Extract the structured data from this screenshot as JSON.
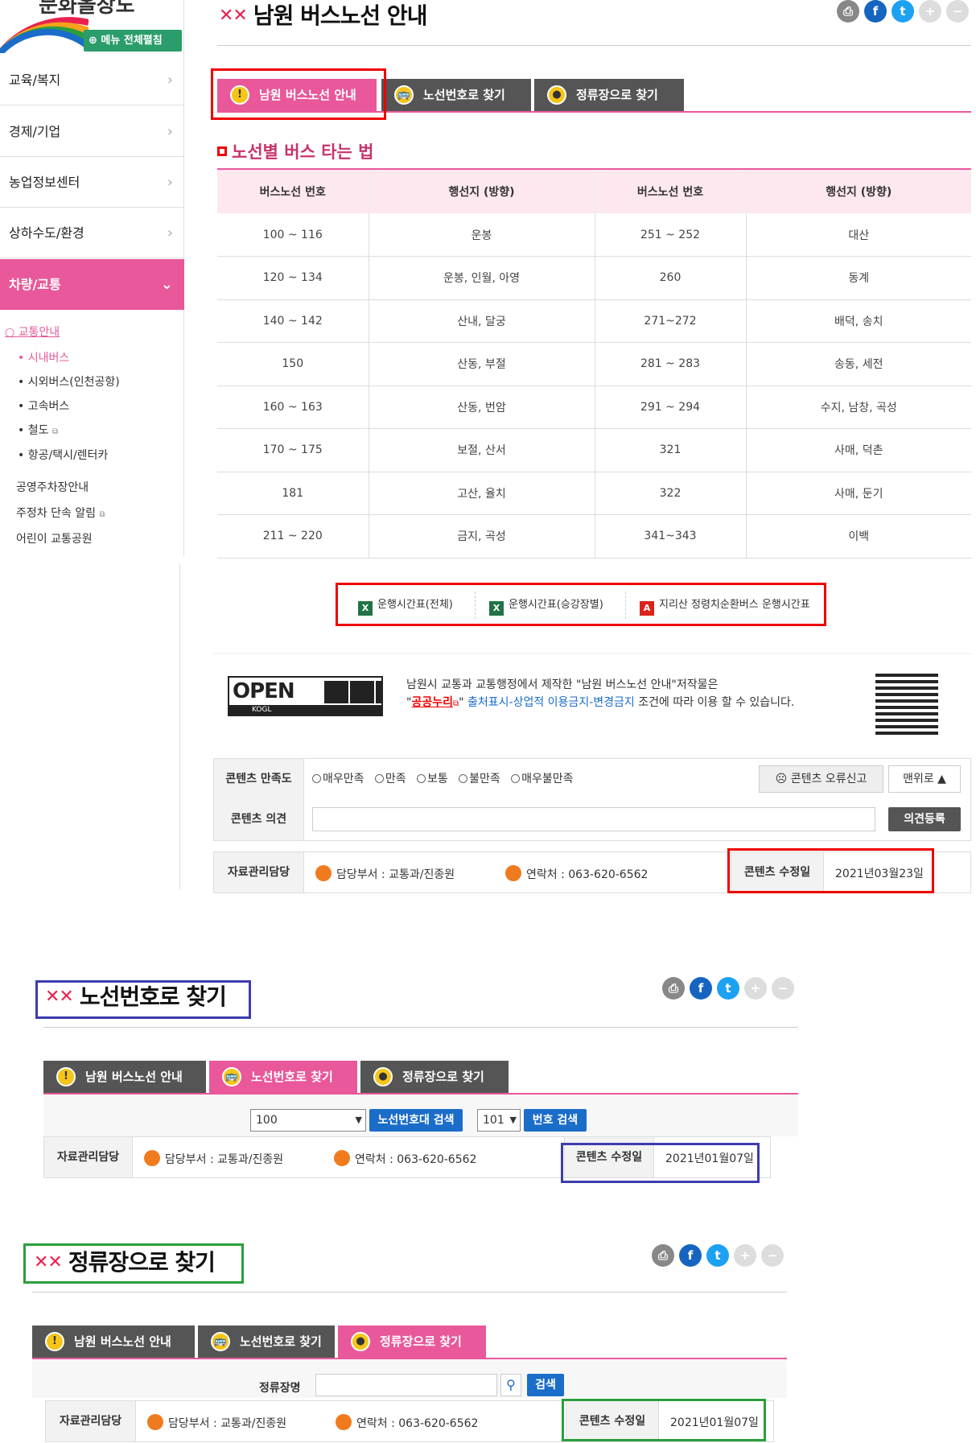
{
  "sidebar": {
    "logo_text": "문화올장도",
    "menu_all_label": "메뉴 전체펼침",
    "items": [
      {
        "label": "교육/복지"
      },
      {
        "label": "경제/기업"
      },
      {
        "label": "농업정보센터"
      },
      {
        "label": "상하수도/환경"
      },
      {
        "label": "차량/교통"
      }
    ],
    "sub_title": "교통안내",
    "sub_items": [
      "시내버스",
      "시외버스(인천공항)",
      "고속버스",
      "철도",
      "항공/택시/렌터카"
    ],
    "extra_items": [
      "공영주차장안내",
      "주정차 단속 알림",
      "어린이 교통공원"
    ]
  },
  "share_icons": [
    "print-icon",
    "facebook-icon",
    "twitter-icon",
    "plus-icon",
    "minus-icon"
  ],
  "tabs": [
    {
      "label": "남원 버스노선 안내",
      "icon": "info-icon"
    },
    {
      "label": "노선번호로 찾기",
      "icon": "bus-icon"
    },
    {
      "label": "정류장으로 찾기",
      "icon": "stop-icon"
    }
  ],
  "section1": {
    "title": "남원 버스노선 안내",
    "subtitle": "노선별 버스 타는 법",
    "table_headers": [
      "버스노선 번호",
      "행선지 (방향)",
      "버스노선 번호",
      "행선지 (방향)"
    ],
    "rows": [
      [
        "100 ~ 116",
        "운봉",
        "251 ~ 252",
        "대산"
      ],
      [
        "120 ~ 134",
        "운봉, 인월, 아영",
        "260",
        "동계"
      ],
      [
        "140 ~ 142",
        "산내, 달궁",
        "271~272",
        "배덕, 송치"
      ],
      [
        "150",
        "산동, 부절",
        "281 ~ 283",
        "송동, 세전"
      ],
      [
        "160 ~ 163",
        "산동, 번암",
        "291 ~ 294",
        "수지, 남창, 곡성"
      ],
      [
        "170 ~ 175",
        "보절, 산서",
        "321",
        "사매, 덕촌"
      ],
      [
        "181",
        "고산, 율치",
        "322",
        "사매, 둔기"
      ],
      [
        "211 ~ 220",
        "금지, 곡성",
        "341~343",
        "이백"
      ]
    ],
    "downloads": [
      "운행시간표(전체)",
      "운행시간표(승강장별)",
      "지리산 정령치순환버스 운행시간표"
    ],
    "license": {
      "kogl_open": "OPEN",
      "kogl_label": "KOGL",
      "line1": "남원시 교통과 교통행정에서 제작한 \"남원 버스노선 안내\"저작물은",
      "link": "공공누리",
      "line2_blue": "출처표시-상업적 이용금지-변경금지",
      "line2_end": "조건에 따라 이용 할 수 있습니다."
    },
    "satisfaction_label": "콘텐츠 만족도",
    "satisfaction_options": [
      "매우만족",
      "만족",
      "보통",
      "불만족",
      "매우불만족"
    ],
    "error_report": "콘텐츠 오류신고",
    "top_button": "맨위로",
    "opinion_label": "콘텐츠 의견",
    "opinion_submit": "의견등록",
    "manager_label": "자료관리담당",
    "dept": "담당부서 : 교통과/진종원",
    "contact": "연락처 : 063-620-6562",
    "modified_label": "콘텐츠 수정일",
    "modified_date": "2021년03월23일"
  },
  "section2": {
    "title": "노선번호로 찾기",
    "select1_value": "100",
    "search_range_button": "노선번호대 검색",
    "select2_value": "101",
    "search_number_button": "번호 검색",
    "manager_label": "자료관리담당",
    "dept": "담당부서 : 교통과/진종원",
    "contact": "연락처 : 063-620-6562",
    "modified_label": "콘텐츠 수정일",
    "modified_date": "2021년01월07일"
  },
  "section3": {
    "title": "정류장으로 찾기",
    "stop_label": "정류장명",
    "stop_placeholder": "",
    "search_button": "검색",
    "manager_label": "자료관리담당",
    "dept": "담당부서 : 교통과/진종원",
    "contact": "연락처 : 063-620-6562",
    "modified_label": "콘텐츠 수정일",
    "modified_date": "2021년01월07일"
  }
}
